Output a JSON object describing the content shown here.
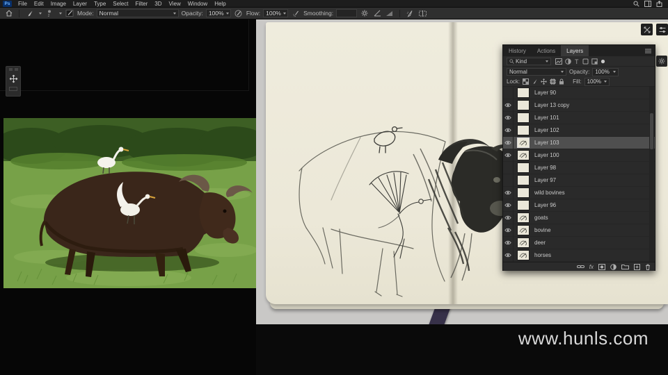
{
  "menu_bar": {
    "logo": "Ps",
    "items": [
      "File",
      "Edit",
      "Image",
      "Layer",
      "Type",
      "Select",
      "Filter",
      "3D",
      "View",
      "Window",
      "Help"
    ]
  },
  "options_bar": {
    "mode_label": "Mode:",
    "mode_value": "Normal",
    "opacity_label": "Opacity:",
    "opacity_value": "100%",
    "flow_label": "Flow:",
    "flow_value": "100%",
    "smoothing_label": "Smoothing:",
    "smoothing_value": ""
  },
  "layers_panel": {
    "tabs": [
      {
        "label": "History",
        "active": false
      },
      {
        "label": "Actions",
        "active": false
      },
      {
        "label": "Layers",
        "active": true
      }
    ],
    "filter_value": "Kind",
    "blend_mode": "Normal",
    "opacity_label": "Opacity:",
    "opacity_value": "100%",
    "lock_label": "Lock:",
    "fill_label": "Fill:",
    "fill_value": "100%",
    "layers": [
      {
        "name": "Layer 90",
        "visible": false,
        "selected": false,
        "thumb": "blank"
      },
      {
        "name": "Layer 13 copy",
        "visible": true,
        "selected": false,
        "thumb": "blank"
      },
      {
        "name": "Layer 101",
        "visible": true,
        "selected": false,
        "thumb": "blank"
      },
      {
        "name": "Layer 102",
        "visible": true,
        "selected": false,
        "thumb": "blank"
      },
      {
        "name": "Layer 103",
        "visible": true,
        "selected": true,
        "thumb": "sketch"
      },
      {
        "name": "Layer 100",
        "visible": true,
        "selected": false,
        "thumb": "sketch"
      },
      {
        "name": "Layer 98",
        "visible": false,
        "selected": false,
        "thumb": "blank"
      },
      {
        "name": "Layer 97",
        "visible": false,
        "selected": false,
        "thumb": "blank"
      },
      {
        "name": "wild bovines",
        "visible": true,
        "selected": false,
        "thumb": "blank"
      },
      {
        "name": "Layer 96",
        "visible": true,
        "selected": false,
        "thumb": "blank"
      },
      {
        "name": "goats",
        "visible": true,
        "selected": false,
        "thumb": "sketch"
      },
      {
        "name": "bovine",
        "visible": true,
        "selected": false,
        "thumb": "sketch"
      },
      {
        "name": "deer",
        "visible": true,
        "selected": false,
        "thumb": "sketch"
      },
      {
        "name": "horses",
        "visible": true,
        "selected": false,
        "thumb": "sketch"
      }
    ],
    "bottom_icons": [
      "link-icon",
      "fx-icon",
      "layer-mask-icon",
      "adjustment-icon",
      "group-icon",
      "new-layer-icon",
      "delete-icon"
    ]
  },
  "watermark": "www.hunls.com",
  "colors": {
    "panel_bg": "#2b2b2b",
    "selected_row": "#4f4f4f",
    "page_cream": "#efecdd",
    "desk_gray": "#c9c8c6",
    "band_black": "#0a0a0a"
  }
}
